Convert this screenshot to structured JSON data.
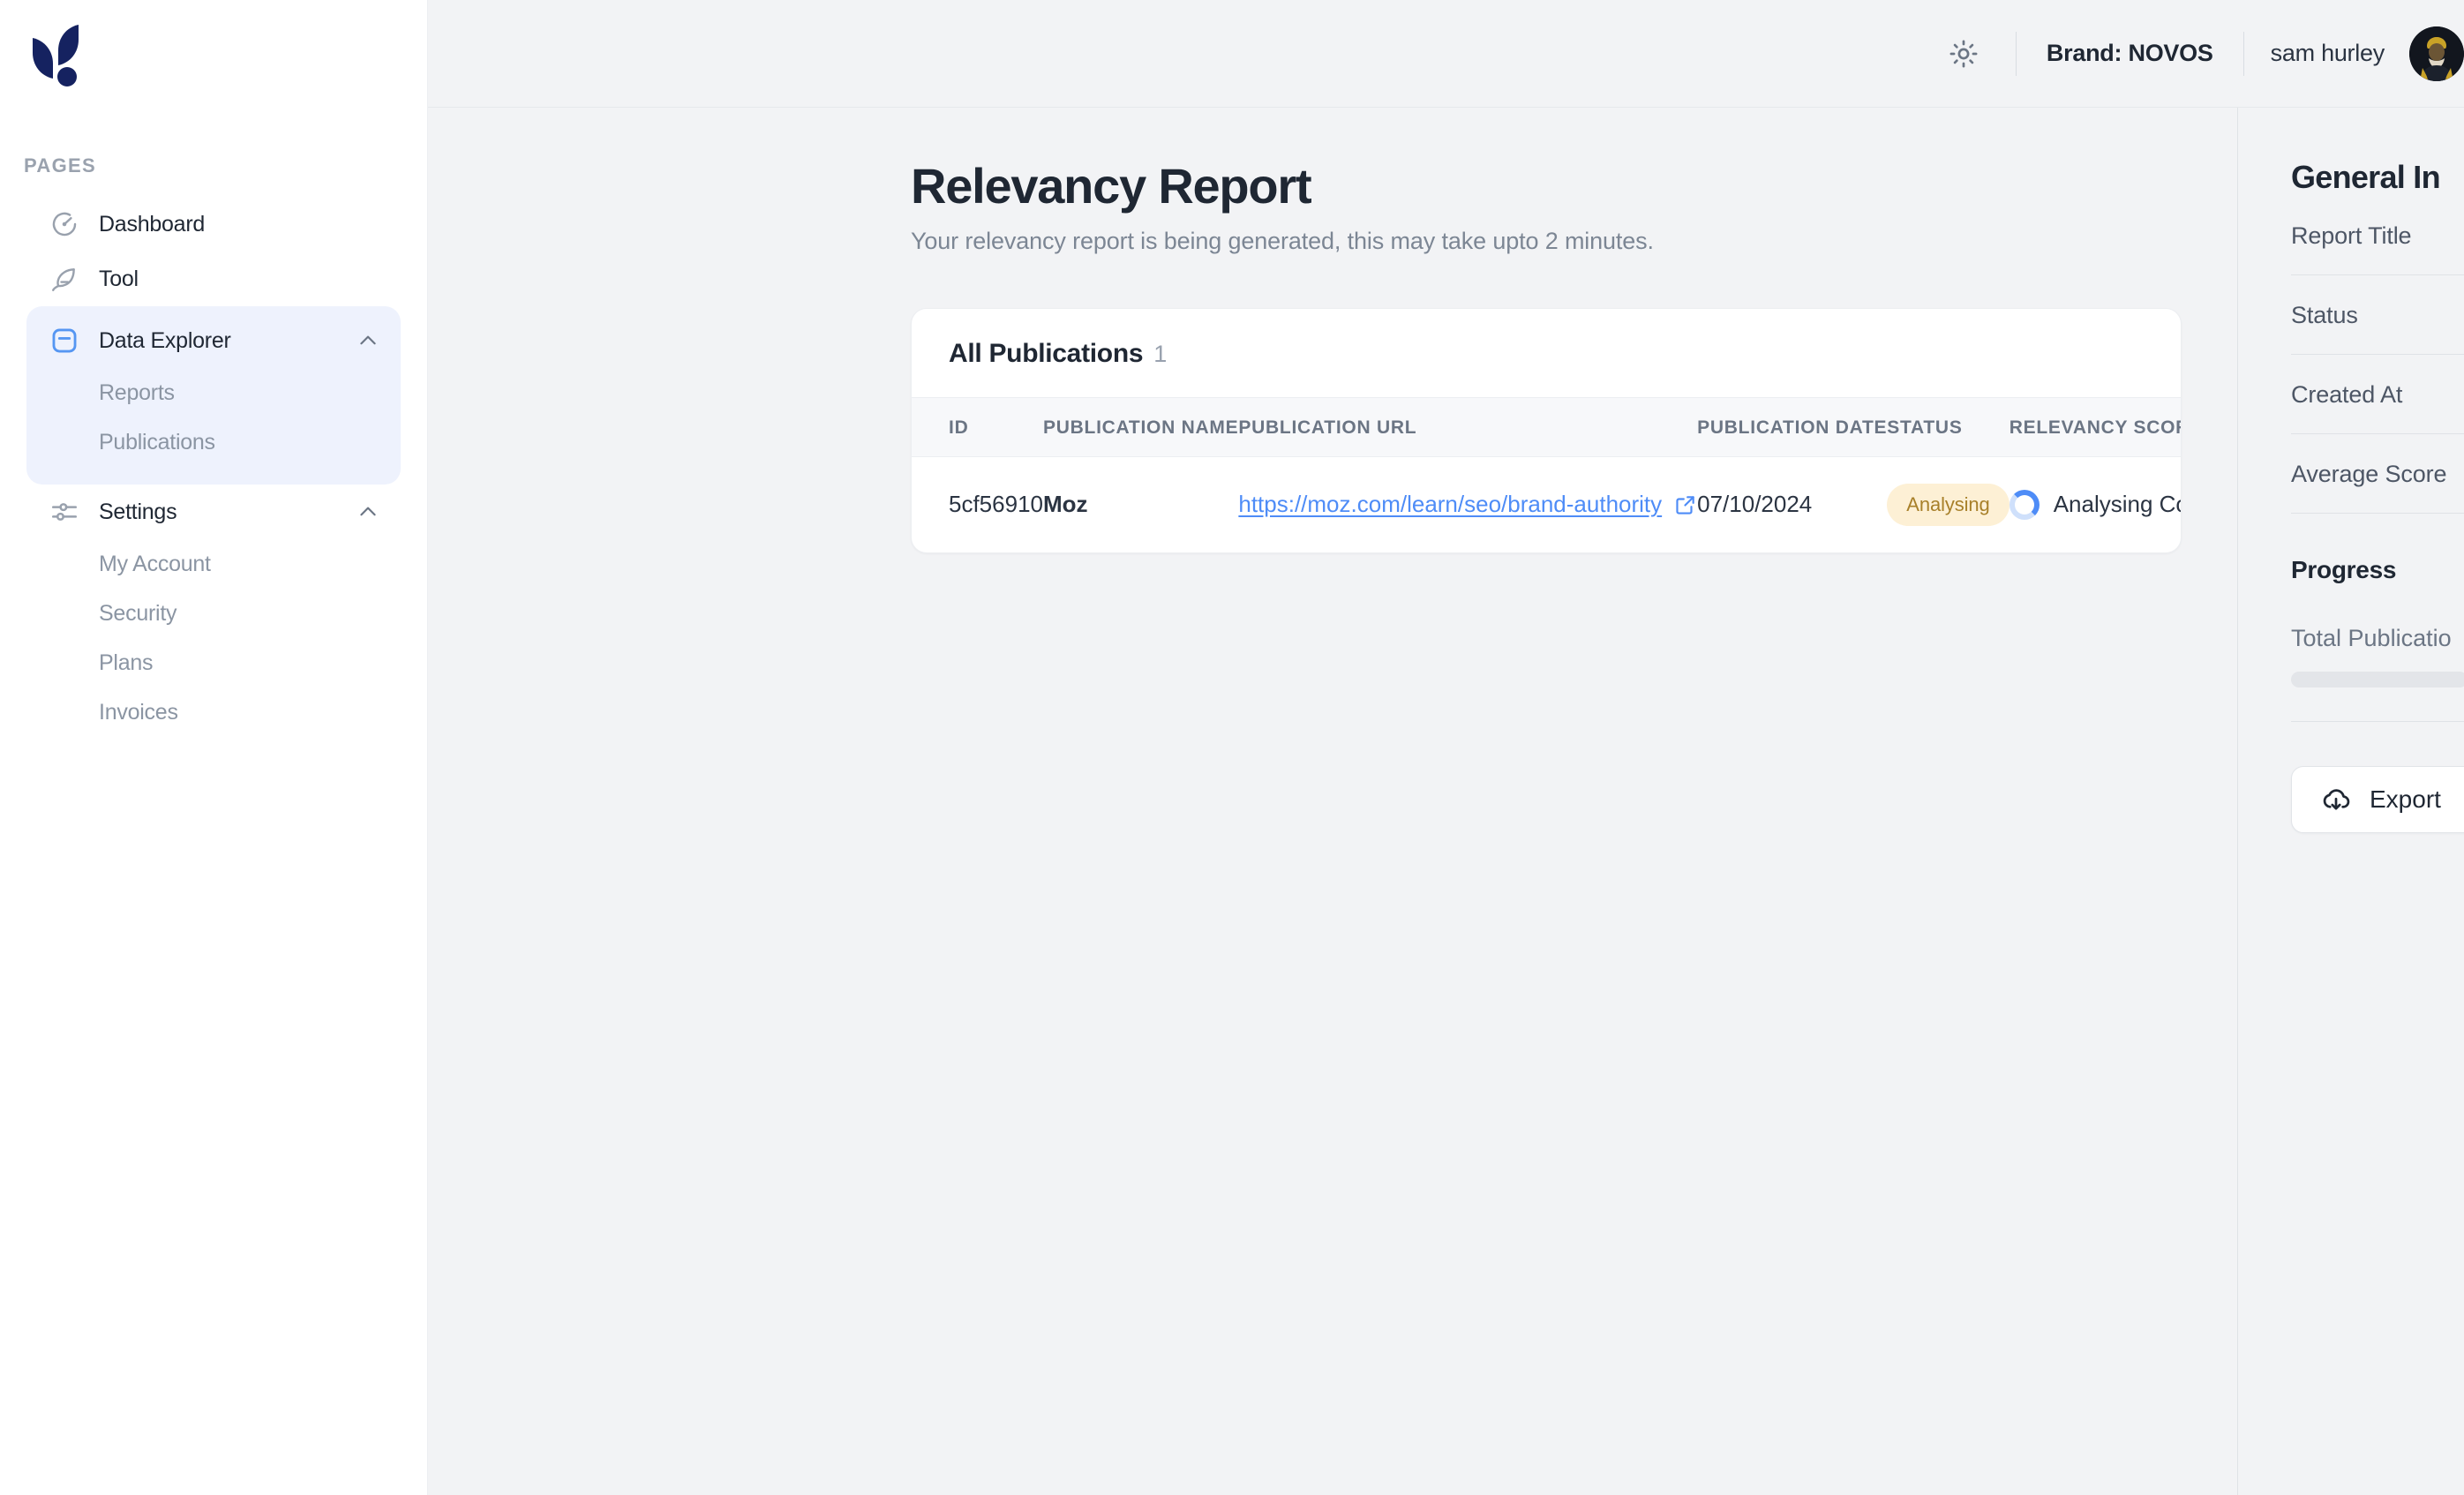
{
  "sidebar": {
    "logo_name": "novos-leaf-logo",
    "section_label": "PAGES",
    "items": [
      {
        "label": "Dashboard",
        "icon": "gauge-icon"
      },
      {
        "label": "Tool",
        "icon": "feather-icon"
      },
      {
        "label": "Data Explorer",
        "icon": "data-explorer-icon",
        "expanded": true,
        "children": [
          {
            "label": "Reports"
          },
          {
            "label": "Publications"
          }
        ]
      },
      {
        "label": "Settings",
        "icon": "sliders-icon",
        "expanded": true,
        "children": [
          {
            "label": "My Account"
          },
          {
            "label": "Security"
          },
          {
            "label": "Plans"
          },
          {
            "label": "Invoices"
          }
        ]
      }
    ]
  },
  "topbar": {
    "theme_icon": "sun-icon",
    "brand": "Brand: NOVOS",
    "user": "sam hurley",
    "avatar_name": "user-avatar"
  },
  "page": {
    "title": "Relevancy Report",
    "subtitle": "Your relevancy report is being generated, this may take upto 2 minutes."
  },
  "card": {
    "title": "All Publications",
    "count": "1",
    "columns": [
      "ID",
      "PUBLICATION NAME",
      "PUBLICATION URL",
      "PUBLICATION DATE",
      "STATUS",
      "RELEVANCY SCORE"
    ],
    "rows": [
      {
        "id": "5cf56910",
        "name": "Moz",
        "url": "https://moz.com/learn/seo/brand-authority",
        "date": "07/10/2024",
        "status": "Analysing",
        "score": "Analysing Content..."
      }
    ]
  },
  "right_panel": {
    "title": "General In",
    "rows": [
      "Report Title",
      "Status",
      "Created At",
      "Average Score"
    ],
    "progress_title": "Progress",
    "progress_label": "Total Publicatio",
    "export_label": "Export",
    "export_icon": "cloud-download-icon"
  },
  "colors": {
    "brand_navy": "#152260",
    "accent_blue": "#4e8cf7",
    "badge_bg": "#fdf0d5",
    "badge_text": "#a8802a",
    "page_bg": "#f2f3f5",
    "nav_highlight": "#eef2fd"
  }
}
